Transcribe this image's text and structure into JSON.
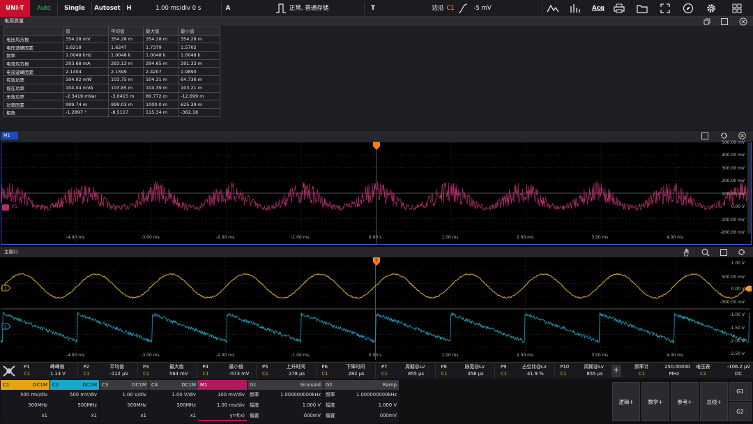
{
  "topbar": {
    "brand": "UNI-T",
    "auto": "Auto",
    "single": "Single",
    "autoset": "Autoset",
    "h_label": "H",
    "timebase": "1.00 ms/div",
    "h_offset": "0 s",
    "a_label": "A",
    "acq_mode": "正常, 普通存储",
    "t_label": "T",
    "trig_type": "边沿",
    "trig_src": "C1",
    "trig_level": "-5 mV",
    "acq_label": "Acq"
  },
  "power_panel": {
    "title": "电源质量",
    "headers": [
      "",
      "值",
      "平均值",
      "最大值",
      "最小值"
    ],
    "rows": [
      [
        "电压均方根",
        "354.28 mV",
        "354.28 m",
        "354.28 m",
        "354.28 m"
      ],
      [
        "电压波峰因素",
        "1.6218",
        "1.6247",
        "1.7379",
        "1.5702"
      ],
      [
        "频率",
        "1.0048 kHz",
        "1.0048 k",
        "1.0048 k",
        "1.0048 k"
      ],
      [
        "电流均方根",
        "293.68 mA",
        "293.13 m",
        "294.65 m",
        "291.33 m"
      ],
      [
        "电流波峰因素",
        "2.1404",
        "2.1599",
        "2.4207",
        "1.9890"
      ],
      [
        "有效功率",
        "104.02 mW",
        "103.75 m",
        "104.31 m",
        "64.736 m"
      ],
      [
        "视在功率",
        "104.04 mVA",
        "103.85 m",
        "104.39 m",
        "103.21 m"
      ],
      [
        "无效功率",
        "-2.3419 mVar",
        "-3.0415 m",
        "80.772 m",
        "-12.699 m"
      ],
      [
        "功率因素",
        "999.74 m",
        "999.03 m",
        "1000.0 m",
        "625.39 m"
      ],
      [
        "相角",
        "-1.2897 °",
        "-8.5117",
        "115.34 m",
        "-362.18"
      ]
    ]
  },
  "m1_window": {
    "tab": "M1",
    "trace_label": "V1",
    "y_labels": [
      "500.00 mV",
      "400.00 mV",
      "300.00 mV",
      "200.00 mV",
      "100.00 mV",
      "0.00 V",
      "-100.00 mV",
      "-200.00 mV"
    ],
    "x_labels": [
      "-4.00 ms",
      "-3.00 ms",
      "-2.00 ms",
      "-1.00 ms",
      "0.00 s",
      "1.00 ms",
      "2.00 ms",
      "3.00 ms",
      "4.00 ms"
    ]
  },
  "main_window": {
    "title": "主窗口",
    "y_labels": [
      "1.00 V",
      "500.00 mV",
      "0.00 V",
      "-500.00 mV",
      "-1.00 V",
      "-1.50 V",
      "-2.00 V",
      "-2.50 V"
    ],
    "x_labels": [
      "-4.00 ms",
      "-3.00 ms",
      "-2.00 ms",
      "-1.00 ms",
      "0.00 s",
      "1.00 ms",
      "2.00 ms",
      "3.00 ms",
      "4.00 ms"
    ],
    "ch1_marker": "1",
    "ch2_marker": "2"
  },
  "measurements": [
    {
      "id": "P1",
      "src": "C1",
      "name": "峰峰值",
      "value": "1.13 V"
    },
    {
      "id": "P2",
      "src": "C1",
      "name": "平均值",
      "value": "-112 μV"
    },
    {
      "id": "P3",
      "src": "C1",
      "name": "最大值",
      "value": "564 mV"
    },
    {
      "id": "P4",
      "src": "C1",
      "name": "最小值",
      "value": "-573 mV"
    },
    {
      "id": "P5",
      "src": "C1",
      "name": "上升时间",
      "value": "278 μs"
    },
    {
      "id": "P6",
      "src": "C1",
      "name": "下降时间",
      "value": "282 μs"
    },
    {
      "id": "P7",
      "src": "C1",
      "name": "周期@Lv",
      "value": "855 μs"
    },
    {
      "id": "P8",
      "src": "C1",
      "name": "脉宽@Lv",
      "value": "358 μs"
    },
    {
      "id": "P9",
      "src": "C1",
      "name": "占空比@Lv",
      "value": "41.9 %"
    },
    {
      "id": "P10",
      "src": "C1",
      "name": "周期@Lv",
      "value": "855 μs"
    }
  ],
  "add_measure": "+",
  "counter": {
    "label": "频率计",
    "src": "C1",
    "value": "250.00000",
    "unit": "MHz"
  },
  "voltmeter": {
    "label": "电压表",
    "src": "C1",
    "value": "-106.2 μV",
    "unit": "DC"
  },
  "channels": [
    {
      "name": "C1",
      "coupling": "DC1M",
      "scale": "500 mV/div",
      "bw": "500MHz",
      "probe": "x1",
      "color": "#e8a317"
    },
    {
      "name": "C2",
      "coupling": "DC1M",
      "scale": "500 mV/div",
      "bw": "500MHz",
      "probe": "x1",
      "color": "#16a9c8"
    },
    {
      "name": "C3",
      "coupling": "DC1M",
      "scale": "1.00 V/div",
      "bw": "500MHz",
      "probe": "x1",
      "color": "#3a3a3f"
    },
    {
      "name": "C4",
      "coupling": "DC1M",
      "scale": "1.00 V/div",
      "bw": "500MHz",
      "probe": "x1",
      "color": "#3a3a3f"
    }
  ],
  "math": {
    "name": "M1",
    "scale": "100 mV/div",
    "timebase": "1.00 ms/div",
    "func": "y=f(x)",
    "color": "#b0195e"
  },
  "gens": [
    {
      "name": "G1",
      "wave": "Sinusoid",
      "freq_label": "频率",
      "freq": "1.000000000kHz",
      "amp_label": "幅度",
      "amp": "1.000 V",
      "off_label": "偏置",
      "off": "000mV"
    },
    {
      "name": "G2",
      "wave": "Ramp",
      "freq_label": "频率",
      "freq": "1.000000000kHz",
      "amp_label": "幅度",
      "amp": "1.000 V",
      "off_label": "偏置",
      "off": "000mV"
    }
  ],
  "buttons": {
    "logic": "逻辑+",
    "math": "数学+",
    "ref": "参考+",
    "bus": "总线+",
    "g1": "G1",
    "g2": "G2"
  },
  "colors": {
    "ch1": "#c9a227",
    "ch2": "#1aa3bf",
    "m1": "#b0306a",
    "trigger": "#f07e1f",
    "m1_frame": "#3b57d6"
  }
}
